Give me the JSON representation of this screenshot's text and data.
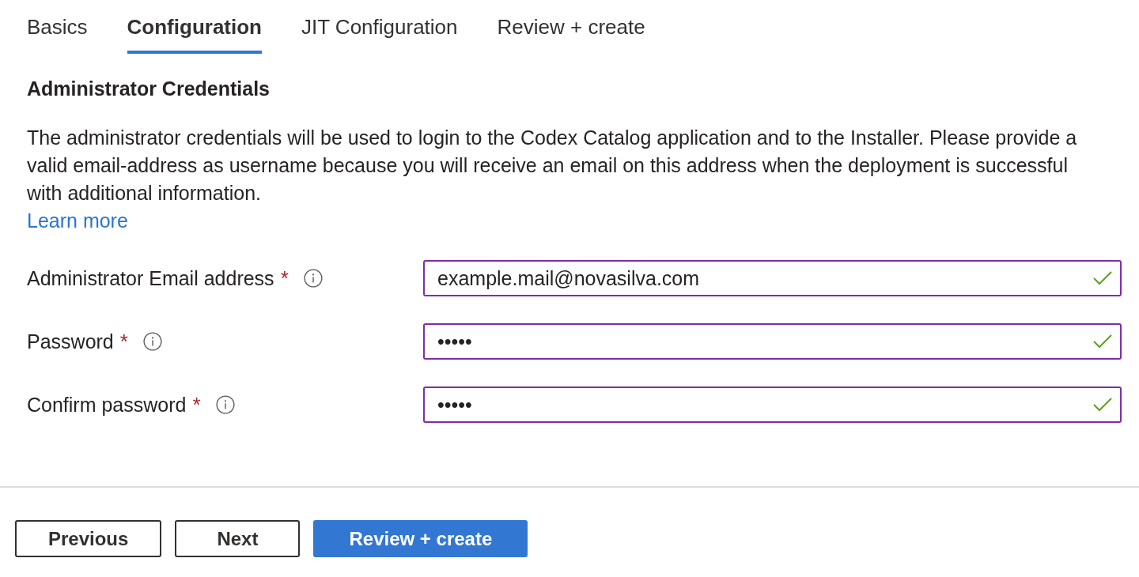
{
  "tabs": [
    {
      "label": "Basics",
      "selected": false
    },
    {
      "label": "Configuration",
      "selected": true
    },
    {
      "label": "JIT Configuration",
      "selected": false
    },
    {
      "label": "Review + create",
      "selected": false
    }
  ],
  "section": {
    "title": "Administrator Credentials",
    "description": "The administrator credentials will be used to login to the Codex Catalog application and to the Installer. Please provide a valid email-address as username because you will receive an email on this address when the deployment is successful with additional information.",
    "link": "Learn more"
  },
  "fields": [
    {
      "label": "Administrator Email address",
      "required_marker": "*",
      "value": "example.mail@novasilva.com",
      "valid": true
    },
    {
      "label": "Password",
      "required_marker": "*",
      "value": "•••••",
      "valid": true
    },
    {
      "label": "Confirm password",
      "required_marker": "*",
      "value": "•••••",
      "valid": true
    }
  ],
  "buttons": [
    {
      "label": "Previous",
      "kind": "secondary"
    },
    {
      "label": "Next",
      "kind": "secondary"
    },
    {
      "label": "Review + create",
      "kind": "primary"
    }
  ]
}
